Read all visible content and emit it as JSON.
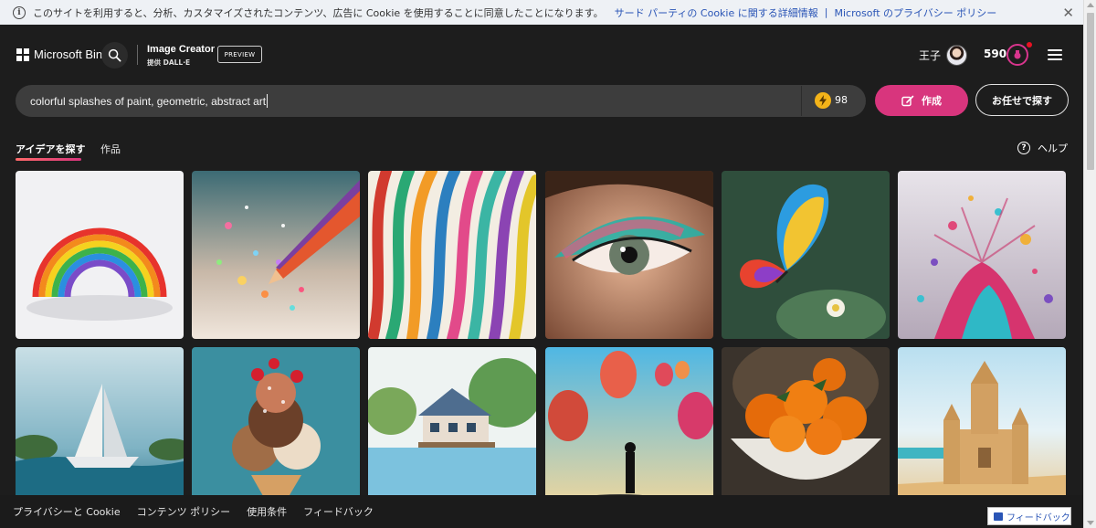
{
  "cookie_banner": {
    "text": "このサイトを利用すると、分析、カスタマイズされたコンテンツ、広告に Cookie を使用することに同意したことになります。",
    "link1": "サード パーティの Cookie に関する詳細情報",
    "separator": "|",
    "link2": "Microsoft のプライバシー ポリシー",
    "close": "✕"
  },
  "header": {
    "brand": "Microsoft Bing",
    "title": "Image Creator",
    "subtitle": "提供 DALL·E",
    "badge": "PREVIEW",
    "user_name": "王子",
    "points": "590"
  },
  "search": {
    "query": "colorful splashes of paint, geometric, abstract art",
    "boosts": "98",
    "create_label": "作成",
    "surprise_label": "お任せで探す"
  },
  "tabs": {
    "explore": "アイデアを探す",
    "works": "作品",
    "help": "ヘルプ"
  },
  "gallery": {
    "items": [
      "rainbow-paper",
      "glitter-pencil",
      "color-ribbons",
      "eye-makeup",
      "rainbow-butterfly",
      "paint-splash",
      "paper-boat",
      "ice-cream-cone",
      "lake-house",
      "hot-air-balloons",
      "oranges-bowl",
      "sandcastle"
    ]
  },
  "footer": {
    "privacy": "プライバシーと Cookie",
    "content_policy": "コンテンツ ポリシー",
    "terms": "使用条件",
    "feedback": "フィードバック",
    "feedback_button": "フィードバック"
  },
  "colors": {
    "accent": "#d8357d",
    "background": "#1d1d1d",
    "search_bg": "#3d3d3d"
  }
}
